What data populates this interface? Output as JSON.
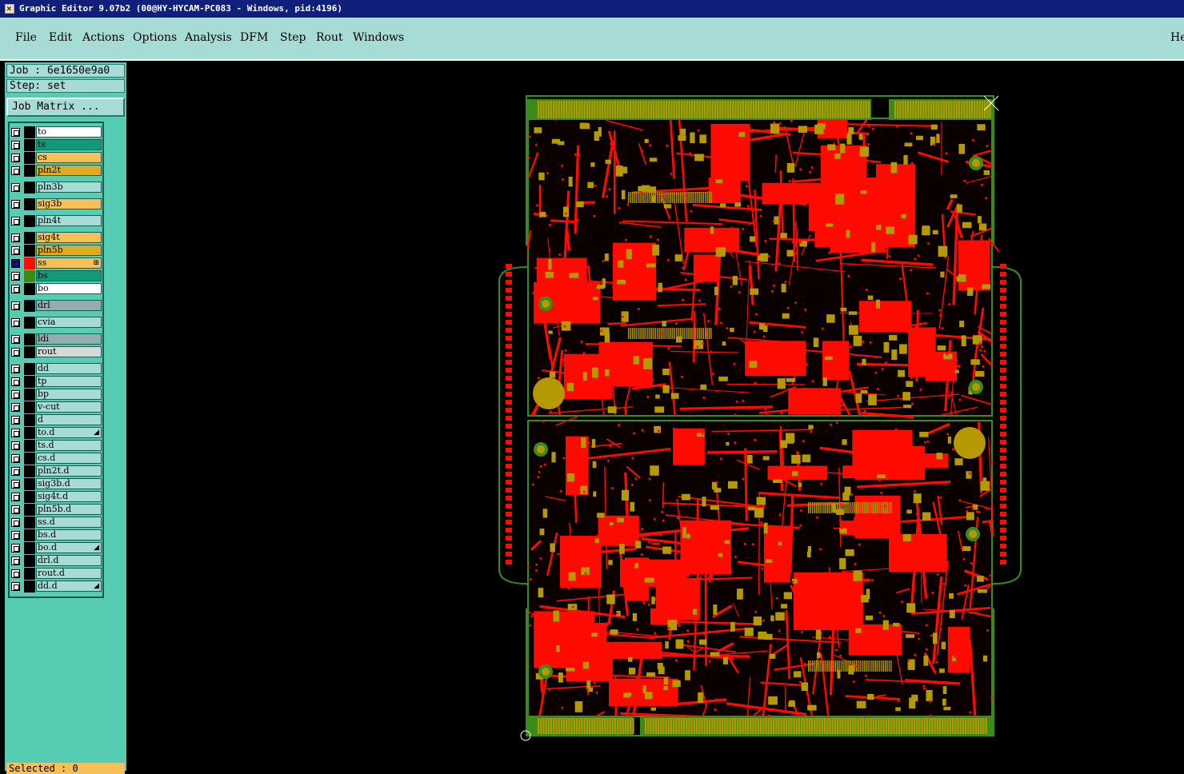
{
  "window": {
    "title": "Graphic Editor 9.07b2 (00@HY-HYCAM-PC083 - Windows, pid:4196)"
  },
  "menu": [
    "File",
    "Edit",
    "Actions",
    "Options",
    "Analysis",
    "DFM",
    "Step",
    "Rout",
    "Windows"
  ],
  "menu_right": "He",
  "job": {
    "label": "Job : 6e1650e9a0",
    "step": "Step: set",
    "matrix_button": "Job Matrix ..."
  },
  "layers": [
    {
      "name": "to",
      "color": "#ffffff"
    },
    {
      "name": "ts",
      "color": "#109a78"
    },
    {
      "name": "cs",
      "color": "#f5c05a"
    },
    {
      "name": "pln2t",
      "color": "#dbac28"
    },
    {
      "name": "pln3b",
      "color": "#a7dcd6"
    },
    {
      "name": "sig3b",
      "color": "#f5c05a"
    },
    {
      "name": "pln4t",
      "color": "#a7dcd6"
    },
    {
      "name": "sig4t",
      "color": "#f5c05a"
    },
    {
      "name": "pln5b",
      "color": "#dbac28"
    },
    {
      "name": "ss",
      "color": "#f5c05a",
      "mark": "⊞"
    },
    {
      "name": "bs",
      "color": "#109a78"
    },
    {
      "name": "bo",
      "color": "#ffffff"
    },
    {
      "name": "drl",
      "color": "#93aeb0"
    },
    {
      "name": "cvia",
      "color": "#a7dcd6"
    },
    {
      "name": "ldi",
      "color": "#93aeb0"
    },
    {
      "name": "rout",
      "color": "#d8d8d8"
    },
    {
      "name": "dd",
      "color": "#a7dcd6"
    },
    {
      "name": "tp",
      "color": "#a7dcd6"
    },
    {
      "name": "bp",
      "color": "#a7dcd6"
    },
    {
      "name": "v-cut",
      "color": "#a7dcd6"
    },
    {
      "name": "d",
      "color": "#a7dcd6"
    },
    {
      "name": "to.d",
      "color": "#a7dcd6",
      "mark": "◢"
    },
    {
      "name": "ts.d",
      "color": "#a7dcd6"
    },
    {
      "name": "cs.d",
      "color": "#a7dcd6"
    },
    {
      "name": "pln2t.d",
      "color": "#a7dcd6"
    },
    {
      "name": "sig3b.d",
      "color": "#a7dcd6"
    },
    {
      "name": "sig4t.d",
      "color": "#a7dcd6"
    },
    {
      "name": "pln5b.d",
      "color": "#a7dcd6"
    },
    {
      "name": "ss.d",
      "color": "#a7dcd6"
    },
    {
      "name": "bs.d",
      "color": "#a7dcd6"
    },
    {
      "name": "bo.d",
      "color": "#a7dcd6",
      "mark": "◢"
    },
    {
      "name": "drl.d",
      "color": "#a7dcd6"
    },
    {
      "name": "rout.d",
      "color": "#a7dcd6"
    },
    {
      "name": "dd.d",
      "color": "#a7dcd6",
      "mark": "◢"
    }
  ],
  "status": {
    "selected": "Selected : 0"
  },
  "colors": {
    "copper": "#ff0a00",
    "gold": "#b49a00",
    "outline": "#3a8c1a",
    "background": "#000000"
  }
}
